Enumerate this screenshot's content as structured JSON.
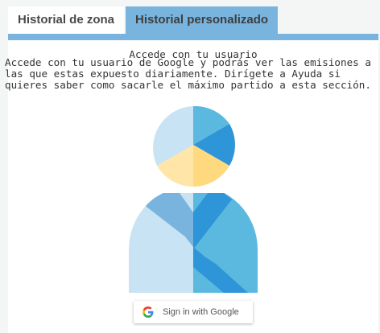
{
  "tabs": [
    {
      "label": "Historial de zona",
      "active": false
    },
    {
      "label": "Historial personalizado",
      "active": true
    }
  ],
  "section": {
    "title": "Accede con tu usuario",
    "description": "Accede con tu usuario de Google y podrás ver las emisiones a las que estas expuesto diariamente. Dirígete a Ayuda si quieres saber como sacarle el máximo partido a esta sección."
  },
  "illustration": {
    "icon": "user-pie-icon"
  },
  "google_button": {
    "label": "Sign in with Google",
    "icon": "google-g-icon"
  },
  "colors": {
    "accent": "#79b4de",
    "light_blue": "#c8e3f4",
    "mid_blue": "#5bb9e0",
    "dark_blue": "#2e95d8",
    "light_yellow": "#ffe6a8",
    "yellow": "#ffd97e"
  }
}
